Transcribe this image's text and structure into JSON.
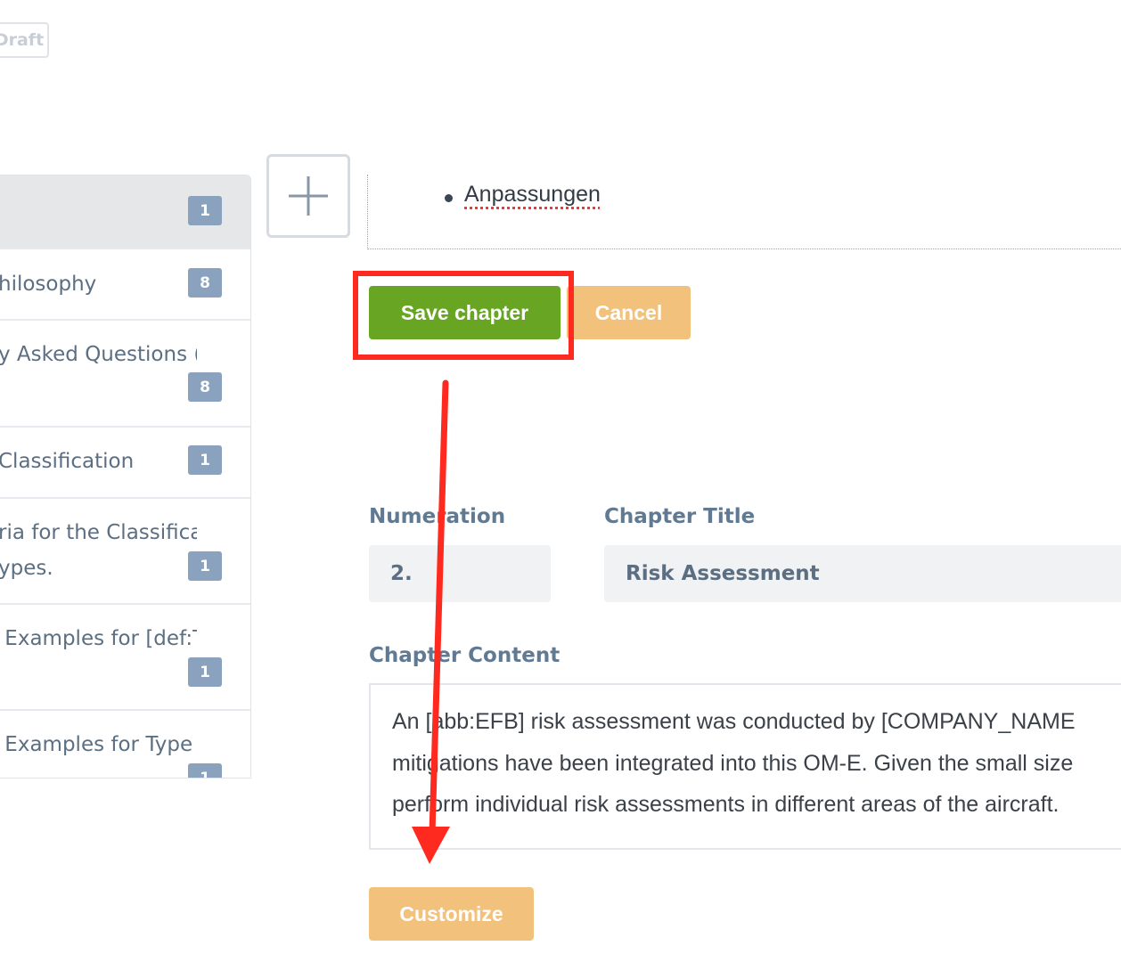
{
  "header": {
    "status_badge": "Draft"
  },
  "sidebar": {
    "items": [
      {
        "label": "",
        "count": "1"
      },
      {
        "label": "hilosophy",
        "count": "8"
      },
      {
        "label": "y Asked Questions (FA",
        "count": "8"
      },
      {
        "label": "Classification",
        "count": "1"
      },
      {
        "label": "ria for the Classificatio\nypes.",
        "count": "1"
      },
      {
        "label": " Examples for [def:Typ",
        "count": "1"
      },
      {
        "label": " Examples for Type B",
        "count": "1"
      }
    ]
  },
  "editor_preview": {
    "bullet_text": "Anpassungen"
  },
  "actions": {
    "save_label": "Save chapter",
    "cancel_label": "Cancel"
  },
  "chapter": {
    "numeration_label": "Numeration",
    "numeration_value": "2.",
    "title_label": "Chapter Title",
    "title_value": "Risk Assessment",
    "content_label": "Chapter Content",
    "content_lines": [
      "An [abb:EFB] risk assessment was conducted by [COMPANY_NAME",
      "mitigations have been integrated into this OM-E. Given the small size",
      "perform individual risk assessments in different areas of the aircraft."
    ]
  },
  "footer": {
    "customize_label": "Customize"
  },
  "colors": {
    "save_green": "#67a523",
    "secondary_orange": "#f2c27c",
    "badge_blue": "#8aa2bd",
    "annotation_red": "#ff2a1f"
  }
}
